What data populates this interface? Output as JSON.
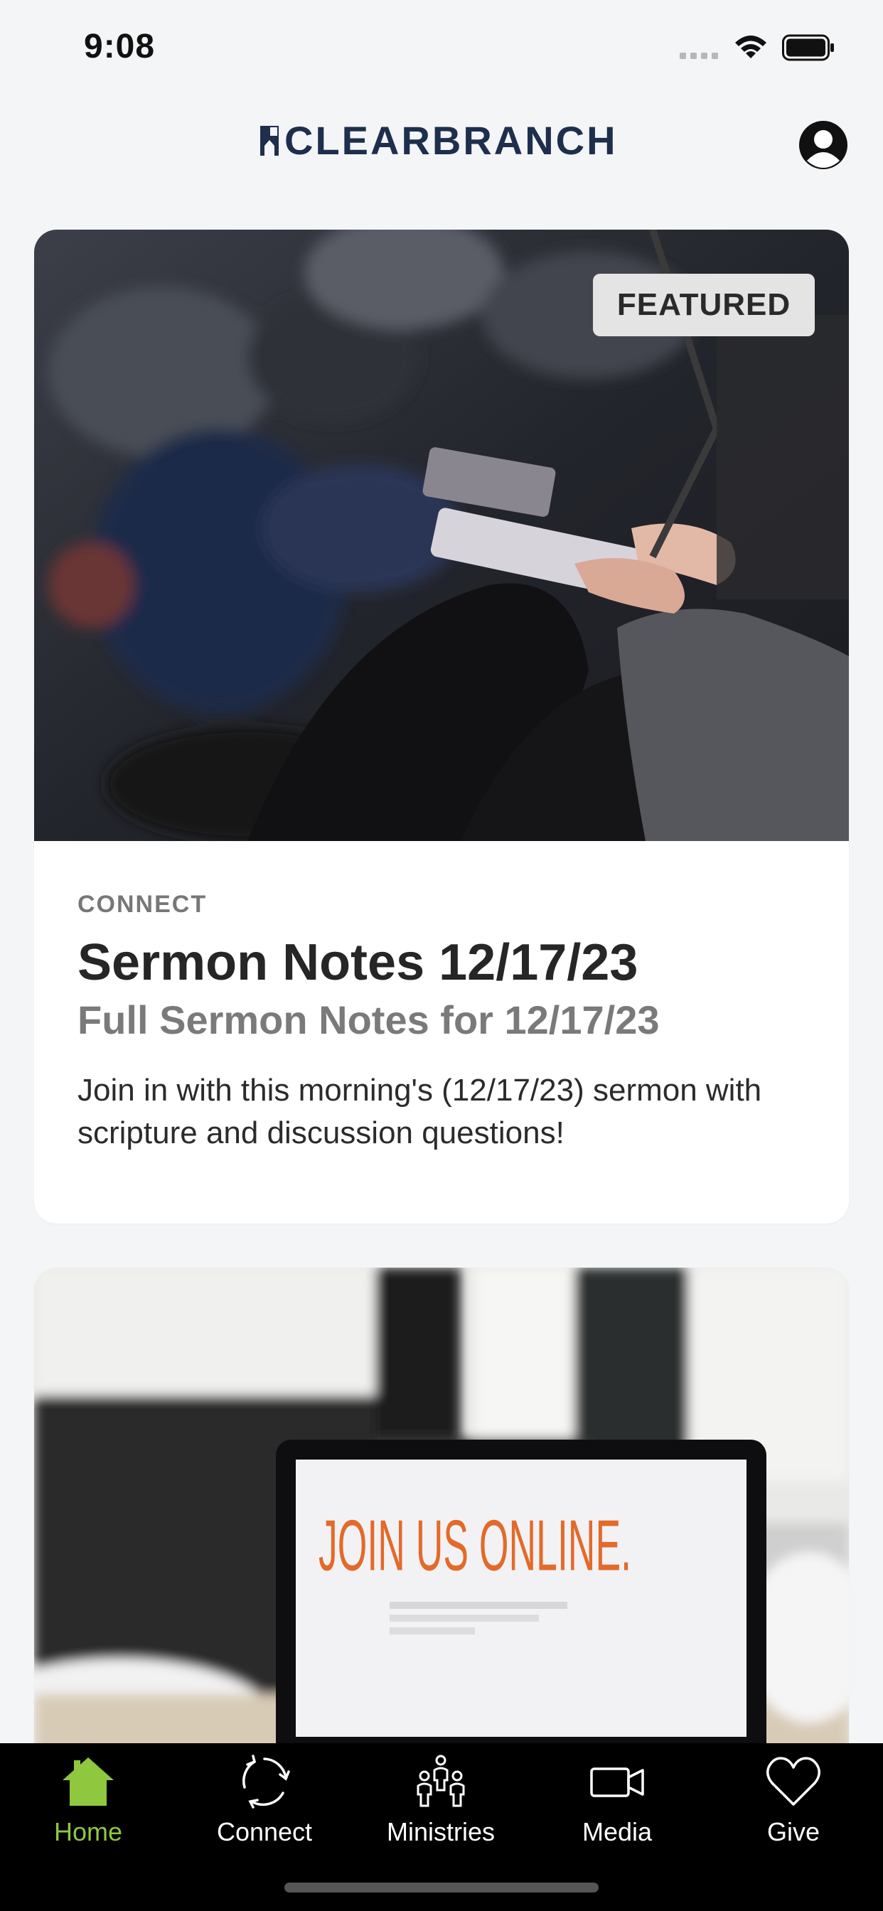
{
  "status_bar": {
    "time": "9:08"
  },
  "header": {
    "logo_text": "CLEARBRANCH",
    "profile_icon": "person-circle-icon"
  },
  "feed": [
    {
      "badge": "FEATURED",
      "category": "CONNECT",
      "title": "Sermon Notes 12/17/23",
      "subtitle": "Full Sermon Notes for 12/17/23",
      "description": "Join in with this morning's (12/17/23) sermon with scripture and discussion questions!"
    },
    {
      "image_text": "JOIN US ONLINE."
    }
  ],
  "tabbar": {
    "items": [
      {
        "label": "Home",
        "icon": "home-icon",
        "active": true
      },
      {
        "label": "Connect",
        "icon": "connect-icon",
        "active": false
      },
      {
        "label": "Ministries",
        "icon": "ministries-icon",
        "active": false
      },
      {
        "label": "Media",
        "icon": "video-icon",
        "active": false
      },
      {
        "label": "Give",
        "icon": "heart-icon",
        "active": false
      }
    ]
  },
  "colors": {
    "accent": "#8fc73e",
    "brand": "#1d2f4c",
    "tabbar_bg": "#000000"
  }
}
